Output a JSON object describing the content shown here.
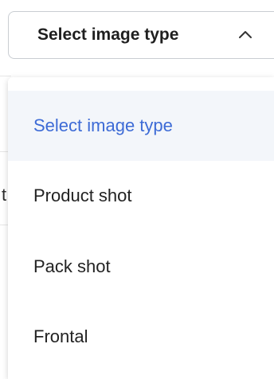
{
  "select": {
    "label": "Select image type",
    "chevron_icon": "chevron-up-icon",
    "expanded": true
  },
  "dropdown": {
    "options": [
      {
        "label": "Select image type",
        "highlighted": true
      },
      {
        "label": "Product shot",
        "highlighted": false
      },
      {
        "label": "Pack shot",
        "highlighted": false
      },
      {
        "label": "Frontal",
        "highlighted": false
      }
    ]
  },
  "background": {
    "fragment": "t"
  },
  "colors": {
    "highlight_text": "#3d6bd6",
    "highlight_bg": "#f3f6fa",
    "border": "#c9cdd2"
  }
}
